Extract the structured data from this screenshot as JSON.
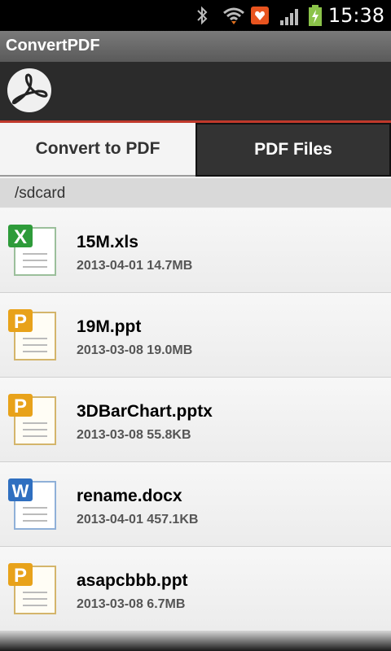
{
  "status_bar": {
    "time": "15:38",
    "icons": [
      "bluetooth-icon",
      "wifi-icon",
      "notification-icon",
      "signal-icon",
      "battery-icon"
    ]
  },
  "app": {
    "title": "ConvertPDF"
  },
  "tabs": [
    {
      "label": "Convert to PDF",
      "selected": false
    },
    {
      "label": "PDF Files",
      "selected": true
    }
  ],
  "path": "/sdcard",
  "files": [
    {
      "name": "15M.xls",
      "meta": "2013-04-01 14.7MB",
      "icon": "excel-file-icon"
    },
    {
      "name": "19M.ppt",
      "meta": "2013-03-08 19.0MB",
      "icon": "powerpoint-file-icon"
    },
    {
      "name": "3DBarChart.pptx",
      "meta": "2013-03-08 55.8KB",
      "icon": "powerpoint-file-icon"
    },
    {
      "name": "rename.docx",
      "meta": "2013-04-01 457.1KB",
      "icon": "word-file-icon"
    },
    {
      "name": "asapcbbb.ppt",
      "meta": "2013-03-08 6.7MB",
      "icon": "powerpoint-file-icon"
    }
  ],
  "colors": {
    "accent": "#c0392b",
    "excel": "#2e9b3a",
    "powerpoint": "#e8a21a",
    "word": "#2f6fc0"
  }
}
